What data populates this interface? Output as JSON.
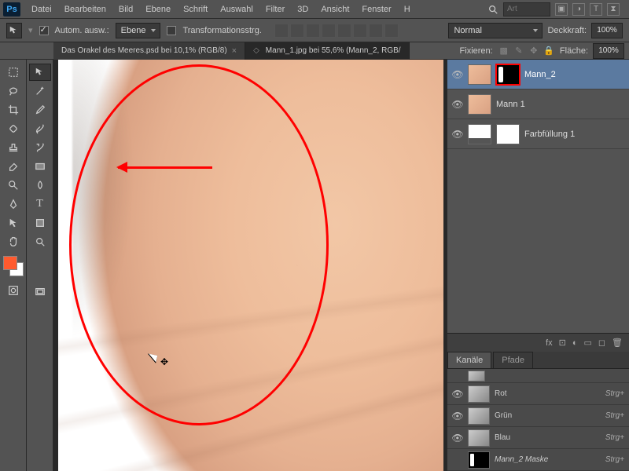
{
  "app": {
    "logo": "Ps"
  },
  "menu": [
    "Datei",
    "Bearbeiten",
    "Bild",
    "Ebene",
    "Schrift",
    "Auswahl",
    "Filter",
    "3D",
    "Ansicht",
    "Fenster",
    "H"
  ],
  "search": {
    "placeholder": "Art"
  },
  "optbar": {
    "auto_select": "Autom. ausw.:",
    "auto_select_target": "Ebene",
    "transform_controls": "Transformationsstrg.",
    "blend_mode": "Normal",
    "opacity_label": "Deckkraft:",
    "opacity": "100%",
    "fill_label": "Fläche:",
    "fill": "100%",
    "lock_label": "Fixieren:"
  },
  "tabs": [
    {
      "title": "Das Orakel des Meeres.psd bei 10,1% (RGB/8)",
      "active": false
    },
    {
      "title": "Mann_1.jpg bei 55,6% (Mann_2, RGB/",
      "active": true
    }
  ],
  "swatch_fg": "#ff5a2e",
  "layers": [
    {
      "name": "Mann_2",
      "selected": true,
      "mask": true,
      "mask_highlight": true
    },
    {
      "name": "Mann 1",
      "selected": false,
      "mask": false
    },
    {
      "name": "Farbfüllung 1",
      "selected": false,
      "fill": true
    }
  ],
  "footer_icons": [
    "fx",
    "⊡",
    "◐",
    "▭",
    "◻",
    "⊞",
    "🗑"
  ],
  "channel_tabs": [
    "Kanäle",
    "Pfade"
  ],
  "channels": [
    {
      "name": "Rot",
      "shortcut": "Strg+"
    },
    {
      "name": "Grün",
      "shortcut": "Strg+"
    },
    {
      "name": "Blau",
      "shortcut": "Strg+"
    },
    {
      "name": "Mann_2 Maske",
      "shortcut": "Strg+",
      "mask": true
    }
  ]
}
